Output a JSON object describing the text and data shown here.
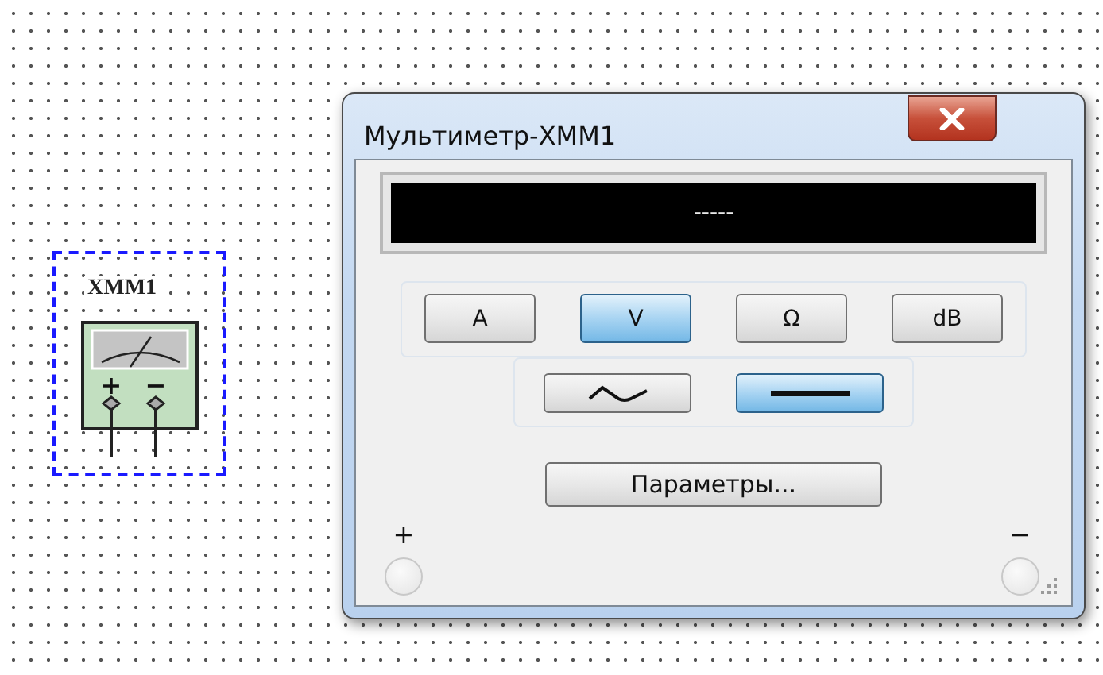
{
  "component": {
    "label": "XMM1",
    "terminals": [
      "+",
      "−"
    ]
  },
  "window": {
    "title": "Мультиметр-XMM1"
  },
  "display": {
    "reading": "-----"
  },
  "mode_buttons": [
    {
      "label": "A",
      "selected": false
    },
    {
      "label": "V",
      "selected": true
    },
    {
      "label": "Ω",
      "selected": false
    },
    {
      "label": "dB",
      "selected": false
    }
  ],
  "signal_buttons": [
    {
      "kind": "ac",
      "selected": false
    },
    {
      "kind": "dc",
      "selected": true
    }
  ],
  "parameters_button": {
    "label": "Параметры..."
  },
  "terminals": [
    {
      "label": "+"
    },
    {
      "label": "−"
    }
  ]
}
